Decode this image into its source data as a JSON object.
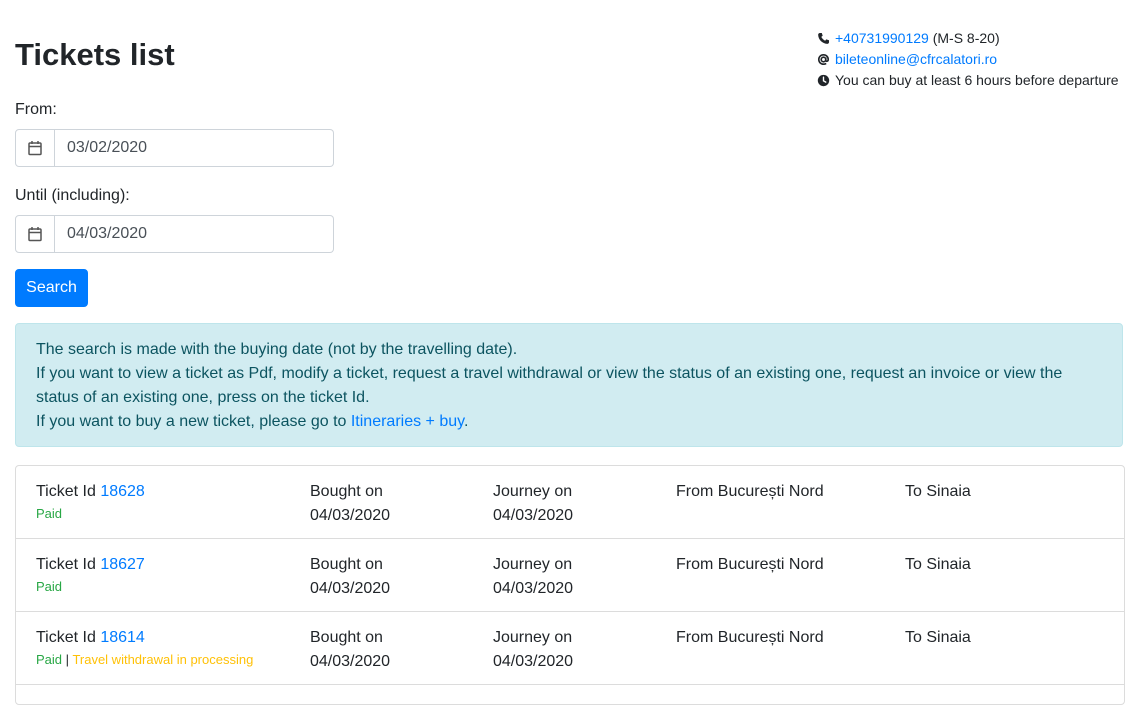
{
  "page": {
    "title": "Tickets list"
  },
  "contact": {
    "phone": "+40731990129",
    "phone_hours": "(M-S 8-20)",
    "email": "bileteonline@cfrcalatori.ro",
    "note": "You can buy at least 6 hours before departure",
    "icons": [
      "phone-icon",
      "at-icon",
      "clock-icon"
    ]
  },
  "form": {
    "from_label": "From:",
    "from_value": "03/02/2020",
    "until_label": "Until (including):",
    "until_value": "04/03/2020",
    "search_label": "Search"
  },
  "info": {
    "line1": "The search is made with the buying date (not by the travelling date).",
    "line2": "If you want to view a ticket as Pdf, modify a ticket, request a travel withdrawal or view the status of an existing one, request an invoice or view the status of an existing one, press on the ticket Id.",
    "line3_prefix": "If you want to buy a new ticket, please go to ",
    "line3_link": "Itineraries + buy",
    "line3_suffix": "."
  },
  "colors": {
    "primary": "#007bff",
    "paid": "#28a745",
    "processing": "#ffc107",
    "info_bg": "#d1ecf1"
  },
  "tickets": {
    "id_label": "Ticket Id",
    "bought_label": "Bought on",
    "journey_label": "Journey on",
    "rows": [
      {
        "id": "18628",
        "status": "Paid",
        "bought": "04/03/2020",
        "journey": "04/03/2020",
        "from": "From București Nord",
        "to": "To Sinaia"
      },
      {
        "id": "18627",
        "status": "Paid",
        "bought": "04/03/2020",
        "journey": "04/03/2020",
        "from": "From București Nord",
        "to": "To Sinaia"
      },
      {
        "id": "18614",
        "status": "Paid",
        "status_separator": "|",
        "status_extra": "Travel withdrawal in processing",
        "bought": "04/03/2020",
        "journey": "04/03/2020",
        "from": "From București Nord",
        "to": "To Sinaia"
      }
    ]
  }
}
